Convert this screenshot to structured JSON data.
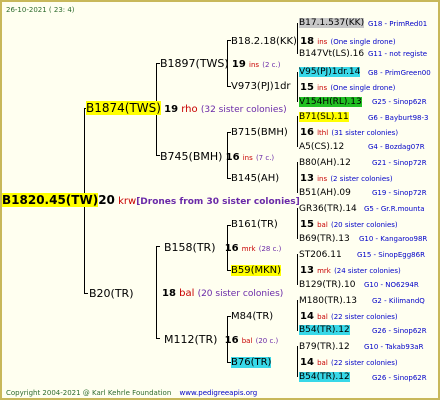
{
  "header": {
    "date": "26-10-2021 ( 23: 4)"
  },
  "footer": {
    "copyright": "Copyright 2004-2021 @ Karl Kehrle Foundation",
    "site": "www.pedigreeapis.org"
  },
  "root": {
    "id": "B1820.45(TW)",
    "num": "20",
    "unit": "krw",
    "note": "[Drones from 30 sister colonies]"
  },
  "g1": {
    "top": {
      "id": "B1874(TWS)",
      "num": "19",
      "unit": "rho",
      "note": "(32 sister colonies)"
    },
    "bottom": {
      "id": "B20(TR)",
      "num": "18",
      "unit": "bal",
      "note": "(20 sister colonies)"
    }
  },
  "g2": {
    "a": {
      "id": "B1897(TWS)",
      "num": "19",
      "unit": "ins",
      "note": "(2 c.)"
    },
    "b": {
      "id": "B745(BMH)",
      "num": "16",
      "unit": "ins",
      "note": "(7 c.)"
    },
    "c": {
      "id": "B158(TR)",
      "num": "16",
      "unit": "mrk",
      "note": "(28 c.)"
    },
    "d": {
      "id": "M112(TR)",
      "num": "16",
      "unit": "bal",
      "note": "(20 c.)"
    }
  },
  "g3": {
    "a1": {
      "id": "B18.2.18(KK)",
      "num": "18",
      "unit": "ins",
      "note": "(One single drone)"
    },
    "a2": {
      "id": "V973(PJ)1dr"
    },
    "a2d": {
      "num": "15",
      "unit": "ins",
      "note": "(One single drone)"
    },
    "b1": {
      "id": "B715(BMH)",
      "num": "16",
      "unit": "lthl",
      "note": "(31 sister colonies)"
    },
    "b2": {
      "id": "B145(AH)",
      "num": "13",
      "unit": "ins",
      "note": "(2 sister colonies)"
    },
    "c1": {
      "id": "B161(TR)",
      "num": "15",
      "unit": "bal",
      "note": "(20 sister colonies)"
    },
    "c2": {
      "id": "B59(MKN)",
      "num": "13",
      "unit": "mrk",
      "note": "(24 sister colonies)"
    },
    "d1": {
      "id": "M84(TR)",
      "num": "14",
      "unit": "bal",
      "note": "(22 sister colonies)"
    },
    "d2": {
      "id": "B76(TR)",
      "num": "14",
      "unit": "bal",
      "note": "(22 sister colonies)"
    }
  },
  "g4": [
    {
      "id": "B17.1.537(KK)",
      "code": "G18 - PrimRed01"
    },
    {
      "id": "B147Vt(LS).16",
      "code": "G11 - not registe"
    },
    {
      "id": "V95(PJ)1dr.14",
      "code": "G8 - PrimGreen00"
    },
    {
      "id": "V154H(RL).13",
      "code": "G25 - Sinop62R"
    },
    {
      "id": "B71(SL).11",
      "code": "G6 - Bayburt98-3"
    },
    {
      "id": "A5(CS).12",
      "code": "G4 - Bozdag07R"
    },
    {
      "id": "B80(AH).12",
      "code": "G21 - Sinop72R"
    },
    {
      "id": "B51(AH).09",
      "code": "G19 - Sinop72R"
    },
    {
      "id": "GR36(TR).14",
      "code": "G5 - Gr.R.mounta"
    },
    {
      "id": "B69(TR).13",
      "code": "G10 - Kangaroo98R"
    },
    {
      "id": "ST206.11",
      "code": "G15 - SinopEgg86R"
    },
    {
      "id": "B129(TR).10",
      "code": "G10 - NO6294R"
    },
    {
      "id": "M180(TR).13",
      "code": "G2 - KilimandQ"
    },
    {
      "id": "B54(TR).12",
      "code": "G26 - Sinop62R"
    },
    {
      "id": "B79(TR).12",
      "code": "G10 - Takab93aR"
    },
    {
      "id": "B54(TR).12",
      "code": "G26 - Sinop62R"
    }
  ],
  "colors": {
    "highlight_yellow": "#ffff00",
    "highlight_cyan": "#38d8e8",
    "highlight_green": "#22c022",
    "highlight_gray": "#c8c8c8",
    "border": "#c8b85a"
  }
}
